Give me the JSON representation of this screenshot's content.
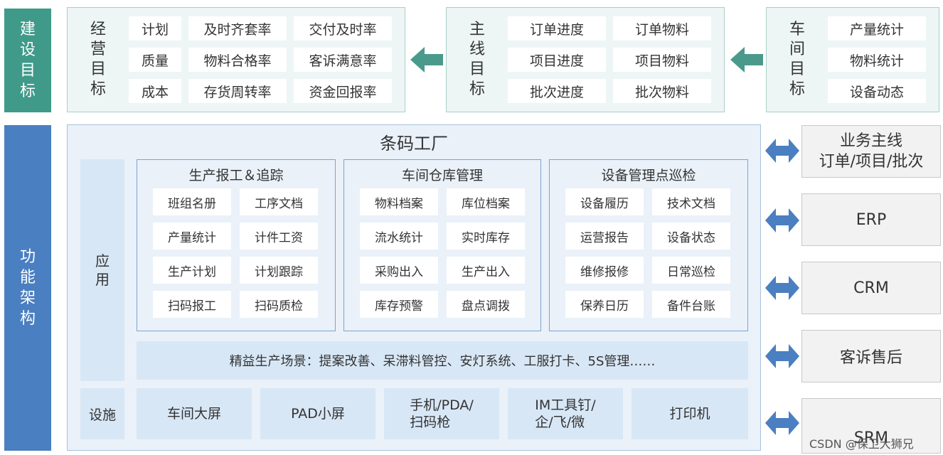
{
  "top_label": "建设目标",
  "bottom_label": "功能架构",
  "business_goals": {
    "title": "经营目标",
    "items": [
      "计划",
      "及时齐套率",
      "交付及时率",
      "质量",
      "物料合格率",
      "客诉满意率",
      "成本",
      "存货周转率",
      "资金回报率"
    ]
  },
  "mainline_goals": {
    "title": "主线目标",
    "items": [
      "订单进度",
      "订单物料",
      "项目进度",
      "项目物料",
      "批次进度",
      "批次物料"
    ]
  },
  "workshop_goals": {
    "title": "车间目标",
    "items": [
      "产量统计",
      "物料统计",
      "设备动态"
    ]
  },
  "factory": {
    "title": "条码工厂",
    "app_label": "应用",
    "infra_label": "设施",
    "modules": [
      {
        "title": "生产报工＆追踪",
        "items": [
          "班组名册",
          "工序文档",
          "产量统计",
          "计件工资",
          "生产计划",
          "计划跟踪",
          "扫码报工",
          "扫码质检"
        ]
      },
      {
        "title": "车间仓库管理",
        "items": [
          "物料档案",
          "库位档案",
          "流水统计",
          "实时库存",
          "采购出入",
          "生产出入",
          "库存预警",
          "盘点调拨"
        ]
      },
      {
        "title": "设备管理点巡检",
        "items": [
          "设备履历",
          "技术文档",
          "运营报告",
          "设备状态",
          "维修报修",
          "日常巡检",
          "保养日历",
          "备件台账"
        ]
      }
    ],
    "lean_scenarios": "精益生产场景：提案改善、呆滞料管控、安灯系统、工服打卡、5S管理……",
    "infrastructure": [
      "车间大屏",
      "PAD小屏",
      "手机/PDA/\n扫码枪",
      "IM工具钉/\n企/飞/微",
      "打印机"
    ]
  },
  "external_systems": [
    {
      "label": "业务主线\n订单/项目/批次"
    },
    {
      "label": "ERP"
    },
    {
      "label": "CRM"
    },
    {
      "label": "客诉售后"
    },
    {
      "label": "SRM"
    }
  ],
  "watermark": "CSDN @保卫大狮兄",
  "colors": {
    "teal": "#3f9a8a",
    "blue": "#4a7fc1",
    "arrow_teal": "#4a9a8c",
    "arrow_blue": "#4a7fc1"
  }
}
